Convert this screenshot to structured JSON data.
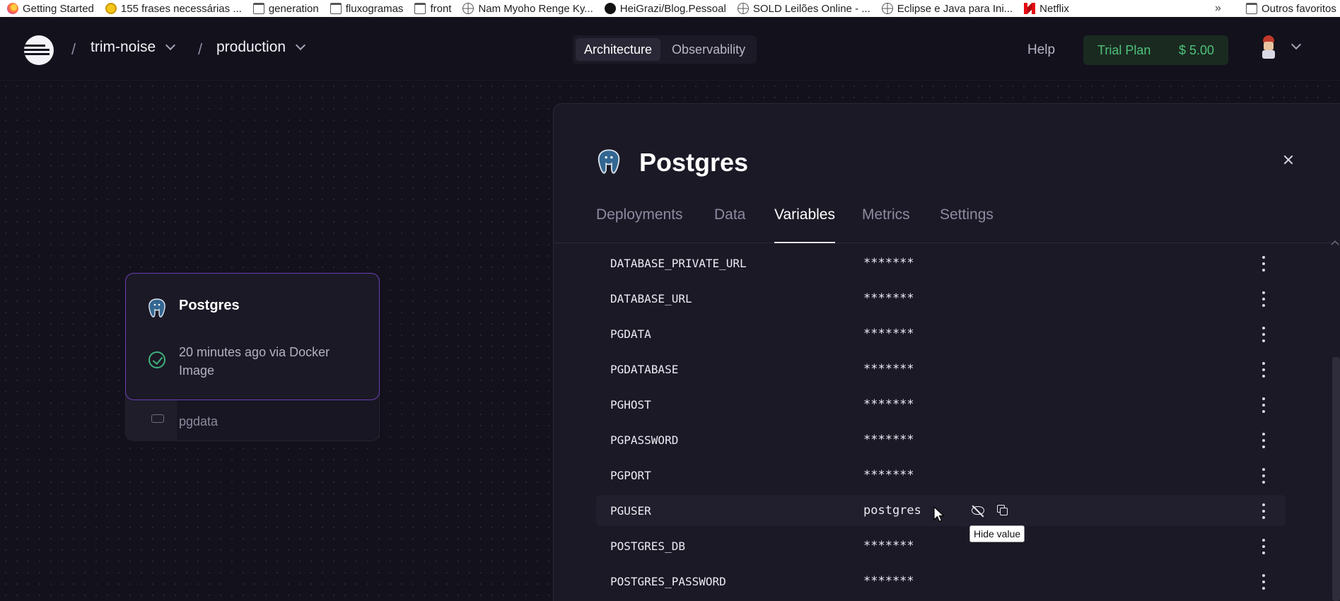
{
  "bookmarks": {
    "items": [
      {
        "label": "Getting Started",
        "icon": "firefox-icon"
      },
      {
        "label": "155 frases necessárias ...",
        "icon": "sun-icon"
      },
      {
        "label": "generation",
        "icon": "folder-icon"
      },
      {
        "label": "fluxogramas",
        "icon": "folder-icon"
      },
      {
        "label": "front",
        "icon": "folder-icon"
      },
      {
        "label": "Nam Myoho Renge Ky...",
        "icon": "globe-icon"
      },
      {
        "label": "HeiGrazi/Blog.Pessoal",
        "icon": "github-icon"
      },
      {
        "label": "SOLD Leilões Online - ...",
        "icon": "globe-icon"
      },
      {
        "label": "Eclipse e Java para Ini...",
        "icon": "globe-icon"
      },
      {
        "label": "Netflix",
        "icon": "netflix-icon"
      }
    ],
    "overflow": "»",
    "other": "Outros favoritos"
  },
  "header": {
    "project": "trim-noise",
    "environment": "production",
    "separator": "/",
    "tabs": [
      "Architecture",
      "Observability"
    ],
    "active_tab": "Architecture",
    "help": "Help",
    "plan": "Trial Plan",
    "credit": "$ 5.00"
  },
  "node": {
    "title": "Postgres",
    "status": "20 minutes ago via Docker Image",
    "volume": "pgdata"
  },
  "panel": {
    "title": "Postgres",
    "tabs": [
      "Deployments",
      "Data",
      "Variables",
      "Metrics",
      "Settings"
    ],
    "active_tab": "Variables",
    "variables": [
      {
        "name": "DATABASE_PRIVATE_URL",
        "value": "*******"
      },
      {
        "name": "DATABASE_URL",
        "value": "*******"
      },
      {
        "name": "PGDATA",
        "value": "*******"
      },
      {
        "name": "PGDATABASE",
        "value": "*******"
      },
      {
        "name": "PGHOST",
        "value": "*******"
      },
      {
        "name": "PGPASSWORD",
        "value": "*******"
      },
      {
        "name": "PGPORT",
        "value": "*******"
      },
      {
        "name": "PGUSER",
        "value": "postgres"
      },
      {
        "name": "POSTGRES_DB",
        "value": "*******"
      },
      {
        "name": "POSTGRES_PASSWORD",
        "value": "*******"
      }
    ],
    "tooltip": "Hide value"
  },
  "colors": {
    "background": "#13111c",
    "panel": "#1b1926",
    "accent_purple": "#6d3fb5",
    "success_green": "#3fb37d",
    "trial_green": "#4ec27a"
  }
}
